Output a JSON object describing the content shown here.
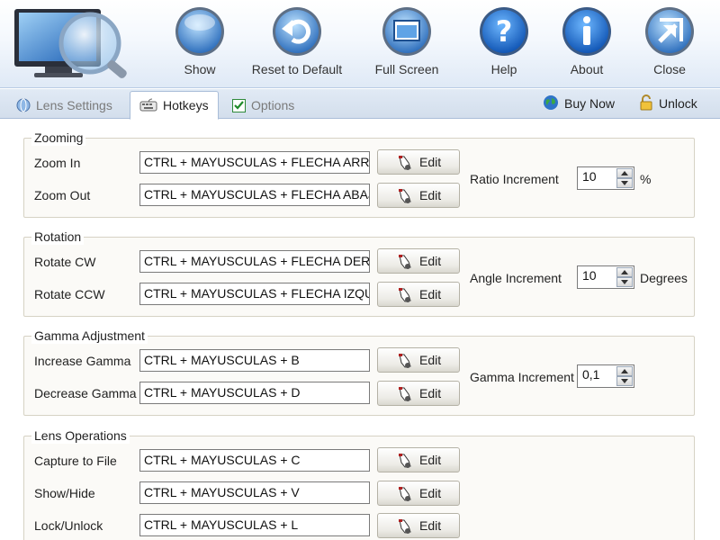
{
  "toolbar": {
    "buttons": [
      {
        "id": "show",
        "label": "Show"
      },
      {
        "id": "reset",
        "label": "Reset to Default"
      },
      {
        "id": "fullscreen",
        "label": "Full Screen"
      },
      {
        "id": "help",
        "label": "Help"
      },
      {
        "id": "about",
        "label": "About"
      },
      {
        "id": "close",
        "label": "Close"
      }
    ]
  },
  "tabs": [
    {
      "label": "Lens Settings",
      "active": false
    },
    {
      "label": "Hotkeys",
      "active": true
    },
    {
      "label": "Options",
      "active": false
    }
  ],
  "tabbar_right": {
    "buy_now": "Buy Now",
    "unlock": "Unlock"
  },
  "edit_label": "Edit",
  "groups": {
    "zooming": {
      "title": "Zooming",
      "rows": [
        {
          "label": "Zoom In",
          "hotkey": "CTRL + MAYUSCULAS + FLECHA ARRIBA"
        },
        {
          "label": "Zoom Out",
          "hotkey": "CTRL + MAYUSCULAS + FLECHA ABAJO"
        }
      ],
      "increment": {
        "label": "Ratio Increment",
        "value": "10",
        "unit": "%"
      }
    },
    "rotation": {
      "title": "Rotation",
      "rows": [
        {
          "label": "Rotate CW",
          "hotkey": "CTRL + MAYUSCULAS + FLECHA DERECHA"
        },
        {
          "label": "Rotate CCW",
          "hotkey": "CTRL + MAYUSCULAS + FLECHA IZQUIERDA"
        }
      ],
      "increment": {
        "label": "Angle Increment",
        "value": "10",
        "unit": "Degrees"
      }
    },
    "gamma": {
      "title": "Gamma Adjustment",
      "rows": [
        {
          "label": "Increase Gamma",
          "hotkey": "CTRL + MAYUSCULAS + B"
        },
        {
          "label": "Decrease Gamma",
          "hotkey": "CTRL + MAYUSCULAS + D"
        }
      ],
      "increment": {
        "label": "Gamma Increment",
        "value": "0,1",
        "unit": ""
      }
    },
    "lens_ops": {
      "title": "Lens Operations",
      "rows": [
        {
          "label": "Capture to File",
          "hotkey": "CTRL + MAYUSCULAS + C"
        },
        {
          "label": "Show/Hide",
          "hotkey": "CTRL + MAYUSCULAS + V"
        },
        {
          "label": "Lock/Unlock",
          "hotkey": "CTRL + MAYUSCULAS + L"
        }
      ]
    }
  },
  "colors": {
    "orb_blue": "#2f7fd3",
    "header_bg": "#dfe9f6",
    "group_border": "#d6d2c4"
  }
}
